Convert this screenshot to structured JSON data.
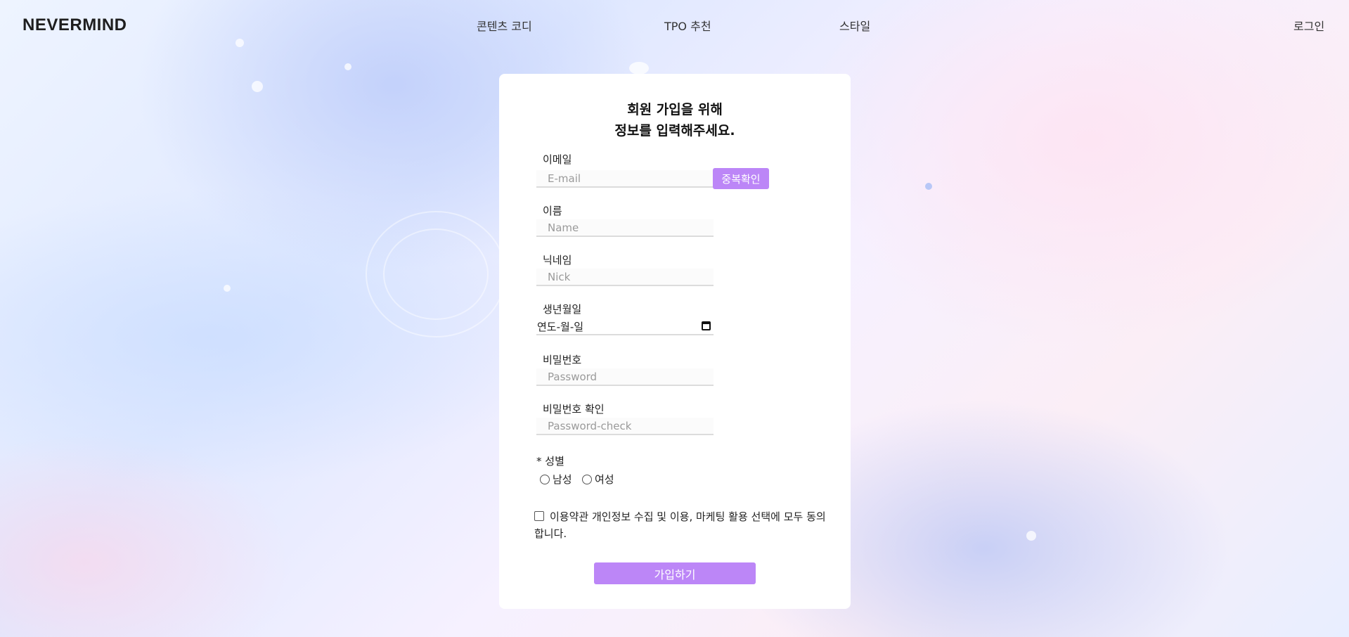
{
  "header": {
    "logo": "NEVERMIND",
    "nav": [
      {
        "label": "콘텐츠 코디"
      },
      {
        "label": "TPO 추천"
      },
      {
        "label": "스타일"
      }
    ],
    "login_label": "로그인"
  },
  "signup": {
    "heading_line1": "회원 가입을 위해",
    "heading_line2": "정보를 입력해주세요.",
    "email": {
      "label": "이메일",
      "placeholder": "E-mail",
      "check_button": "중복확인"
    },
    "name": {
      "label": "이름",
      "placeholder": "Name"
    },
    "nickname": {
      "label": "닉네임",
      "placeholder": "Nick"
    },
    "birth": {
      "label": "생년월일",
      "value": "연도-월-일"
    },
    "password": {
      "label": "비밀번호",
      "placeholder": "Password"
    },
    "password_check": {
      "label": "비밀번호 확인",
      "placeholder": "Password-check"
    },
    "gender": {
      "label": "* 성별",
      "options": [
        "남성",
        "여성"
      ]
    },
    "agree_text": "이용약관 개인정보 수집 및 이용, 마케팅 활용 선택에 모두 동의합니다.",
    "submit_label": "가입하기"
  },
  "colors": {
    "accent": "#bc86f7",
    "card": "#ffffff"
  }
}
